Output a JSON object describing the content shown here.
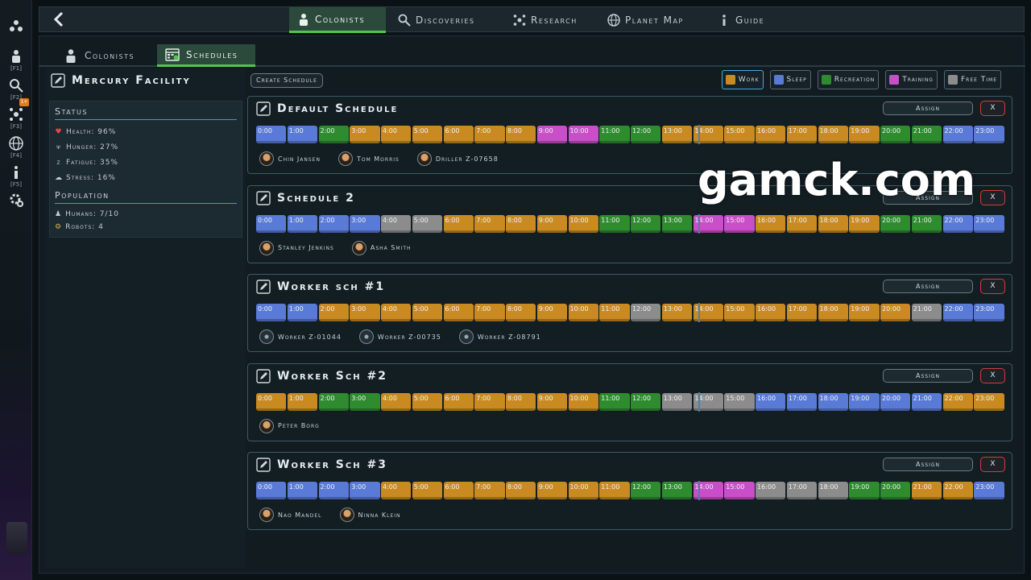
{
  "watermark": "gamck.com",
  "leftbar": {
    "items": [
      {
        "icon": "atom-icon",
        "key": ""
      },
      {
        "icon": "colonists-icon",
        "key": "[F1]"
      },
      {
        "icon": "discoveries-icon",
        "key": "[F2]"
      },
      {
        "icon": "research-icon",
        "key": "[F3]"
      },
      {
        "icon": "planet-icon",
        "key": "[F4]"
      },
      {
        "icon": "guide-icon",
        "key": "[F5]"
      },
      {
        "icon": "settings-icon",
        "key": ""
      }
    ],
    "badge": "1+"
  },
  "topnav": {
    "tabs": [
      {
        "label": "Colonists",
        "icon": "colonists-icon",
        "active": true
      },
      {
        "label": "Discoveries",
        "icon": "discoveries-icon",
        "active": false
      },
      {
        "label": "Research",
        "icon": "research-icon",
        "active": false
      },
      {
        "label": "Planet Map",
        "icon": "planet-icon",
        "active": false
      },
      {
        "label": "Guide",
        "icon": "guide-icon",
        "active": false
      }
    ]
  },
  "subtabs": [
    {
      "label": "Colonists",
      "icon": "colonists-icon",
      "active": false
    },
    {
      "label": "Schedules",
      "icon": "calendar-icon",
      "active": true
    }
  ],
  "facility": {
    "name": "Mercury Facility",
    "status_title": "Status",
    "stats": [
      {
        "icon": "heart-icon",
        "label": "Health: 96%",
        "color": "#e04848"
      },
      {
        "icon": "fork-icon",
        "label": "Hunger: 27%",
        "color": "#cfd8dc"
      },
      {
        "icon": "sleep-icon",
        "label": "Fatigue: 35%",
        "color": "#cfd8dc"
      },
      {
        "icon": "stress-icon",
        "label": "Stress: 16%",
        "color": "#cfd8dc"
      }
    ],
    "population_title": "Population",
    "population": [
      {
        "icon": "human-icon",
        "label": "Humans: 7/10"
      },
      {
        "icon": "robot-icon",
        "label": "Robots: 4"
      }
    ]
  },
  "create_schedule_label": "Create Schedule",
  "legend": [
    {
      "key": "W",
      "label": "Work",
      "color": "#c98a22",
      "active": true
    },
    {
      "key": "S",
      "label": "Sleep",
      "color": "#5a7ad8",
      "active": false
    },
    {
      "key": "R",
      "label": "Recreation",
      "color": "#2e8b2e",
      "active": false
    },
    {
      "key": "T",
      "label": "Training",
      "color": "#c84fc8",
      "active": false
    },
    {
      "key": "F",
      "label": "Free Time",
      "color": "#8c8c8c",
      "active": false
    }
  ],
  "current_hour": 14,
  "schedules": [
    {
      "title": "Default Schedule",
      "assign_label": "Assign",
      "remove_label": "X",
      "hours": [
        "S",
        "S",
        "R",
        "W",
        "W",
        "W",
        "W",
        "W",
        "W",
        "T",
        "T",
        "R",
        "R",
        "W",
        "W",
        "W",
        "W",
        "W",
        "W",
        "W",
        "R",
        "R",
        "S",
        "S"
      ],
      "assignees": [
        {
          "name": "Chin Jansen",
          "type": "human"
        },
        {
          "name": "Tom Morris",
          "type": "human"
        },
        {
          "name": "Driller Z-07658",
          "type": "human"
        }
      ]
    },
    {
      "title": "Schedule 2",
      "assign_label": "Assign",
      "remove_label": "X",
      "hours": [
        "S",
        "S",
        "S",
        "S",
        "F",
        "F",
        "W",
        "W",
        "W",
        "W",
        "W",
        "R",
        "R",
        "R",
        "T",
        "T",
        "W",
        "W",
        "W",
        "W",
        "R",
        "R",
        "S",
        "S"
      ],
      "assignees": [
        {
          "name": "Stanley Jenkins",
          "type": "human"
        },
        {
          "name": "Asha Smith",
          "type": "human"
        }
      ]
    },
    {
      "title": "Worker sch #1",
      "assign_label": "Assign",
      "remove_label": "X",
      "hours": [
        "S",
        "S",
        "W",
        "W",
        "W",
        "W",
        "W",
        "W",
        "W",
        "W",
        "W",
        "W",
        "F",
        "W",
        "W",
        "W",
        "W",
        "W",
        "W",
        "W",
        "W",
        "F",
        "S",
        "S"
      ],
      "assignees": [
        {
          "name": "Worker Z-01044",
          "type": "robot"
        },
        {
          "name": "Worker Z-00735",
          "type": "robot"
        },
        {
          "name": "Worker Z-08791",
          "type": "robot"
        }
      ]
    },
    {
      "title": "Worker Sch #2",
      "assign_label": "Assign",
      "remove_label": "X",
      "hours": [
        "W",
        "W",
        "R",
        "R",
        "W",
        "W",
        "W",
        "W",
        "W",
        "W",
        "W",
        "R",
        "R",
        "F",
        "F",
        "F",
        "S",
        "S",
        "S",
        "S",
        "S",
        "S",
        "W",
        "W"
      ],
      "assignees": [
        {
          "name": "Peter Borg",
          "type": "human"
        }
      ]
    },
    {
      "title": "Worker Sch #3",
      "assign_label": "Assign",
      "remove_label": "X",
      "hours": [
        "S",
        "S",
        "S",
        "S",
        "W",
        "W",
        "W",
        "W",
        "W",
        "W",
        "W",
        "W",
        "R",
        "R",
        "T",
        "T",
        "F",
        "F",
        "F",
        "R",
        "R",
        "W",
        "W",
        "S"
      ],
      "assignees": [
        {
          "name": "Nao Mandel",
          "type": "human"
        },
        {
          "name": "Ninna Klein",
          "type": "human"
        }
      ]
    }
  ]
}
